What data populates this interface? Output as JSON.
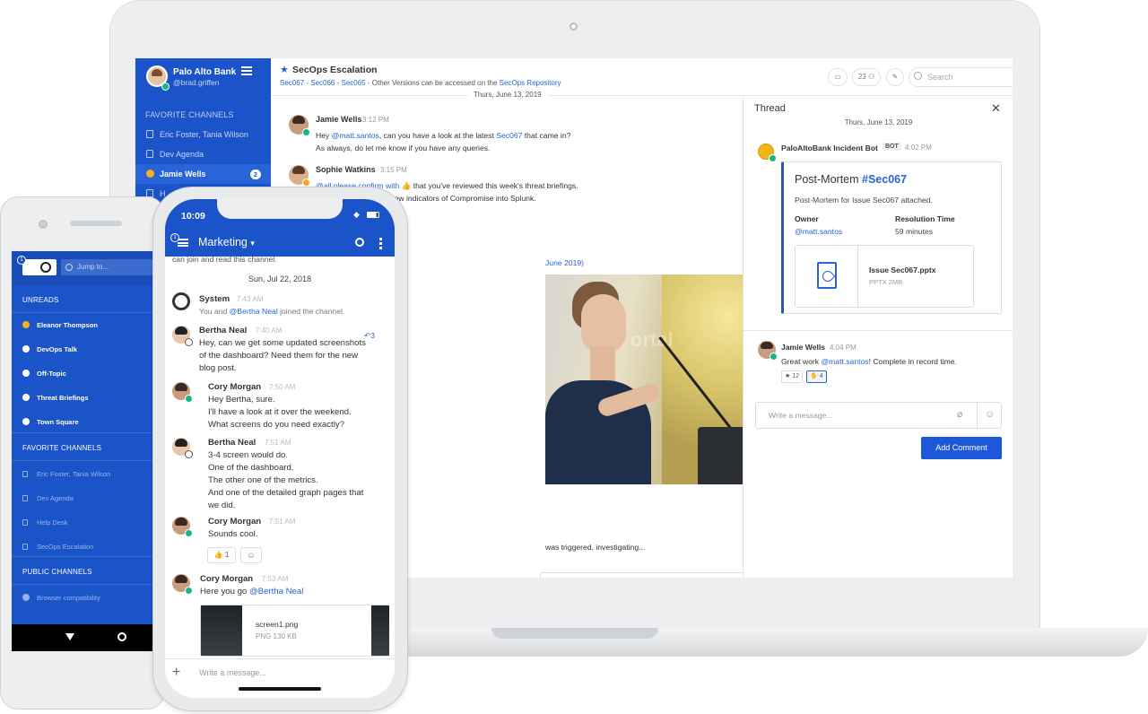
{
  "desktop": {
    "team": {
      "name": "Palo Alto Bank",
      "user": "@brad.griffen"
    },
    "sidebar": {
      "section_favorites": "FAVORITE CHANNELS",
      "items": [
        {
          "label": "Eric Foster, Tania Wilson"
        },
        {
          "label": "Dev Agenda"
        },
        {
          "label": "Jamie Wells",
          "badge": "2"
        },
        {
          "label": "H"
        }
      ]
    },
    "header": {
      "channel": "SecOps Escalation",
      "purpose_links": [
        "Sec067",
        "Sec066",
        "Sec065"
      ],
      "purpose_text": " - Other Versions can be accessed on the ",
      "purpose_repo": "SecOps Repository",
      "member_count": "23",
      "search_placeholder": "Search"
    },
    "center": {
      "date": "Thurs, June 13, 2019",
      "posts": [
        {
          "name": "Jamie Wells",
          "time": "3:12 PM",
          "line1_pre": "Hey ",
          "line1_mention": "@matt.santos",
          "line1_mid": ", can you have a look at the latest ",
          "line1_link": "Sec067",
          "line1_post": " that came in?",
          "line2": "As always, do let me know if you have any queries."
        },
        {
          "name": "Sophie Watkins",
          "time": "3:15 PM",
          "line1_a": "@all please confirm with ",
          "line1_b": " that you've reviewed this week's threat briefings.",
          "line2": "confirm we've loaded new indicators of Compromise into Splunk."
        }
      ],
      "link_text": "June 2019)",
      "tail_text": "was triggered, investigating..."
    },
    "thread": {
      "title": "Thread",
      "date": "Thurs, June 13, 2019",
      "bot_name": "PaloAltoBank Incident Bot",
      "bot_badge": "BOT",
      "bot_time": "4:02 PM",
      "card_title_pre": "Post-Mortem ",
      "card_title_tag": "#Sec067",
      "card_text": "Post-Mortem for Issue Sec067 attached.",
      "owner_label": "Owner",
      "owner_value": "@matt.santos",
      "resolution_label": "Resolution Time",
      "resolution_value": "59 minutes",
      "file_name": "Issue Sec067.pptx",
      "file_size": "PPTX 2MB",
      "reply_name": "Jamie Wells",
      "reply_time": "4:04 PM",
      "reply_pre": "Great work ",
      "reply_mention": "@matt.santos",
      "reply_post": "! Complete in record time.",
      "reaction1_count": "12",
      "reaction2_count": "4",
      "input_placeholder": "Write a message...",
      "add_button": "Add Comment"
    }
  },
  "android": {
    "badge": "1",
    "jump_placeholder": "Jump to...",
    "sections": {
      "unreads": "UNREADS",
      "favorites": "FAVORITE CHANNELS",
      "public": "PUBLIC CHANNELS"
    },
    "unreads": [
      "Eleanor Thompson",
      "DevOps Talk",
      "Off-Topic",
      "Threat Briefings",
      "Town Square"
    ],
    "favorites": [
      "Eric Foster, Tania Wilson",
      "Dev Agenda",
      "Help Desk",
      "SecOps Escalation"
    ],
    "public": [
      "Browser compatibility"
    ]
  },
  "iphone": {
    "time": "10:09",
    "badge": "1",
    "channel": "Marketing",
    "cut_text": "can join and read this channel.",
    "date": "Sun, Jul 22, 2018",
    "system": {
      "name": "System",
      "time": "7:43 AM",
      "pre": "You and ",
      "mention": "@Bertha Neal",
      "post": " joined the channel."
    },
    "bertha1": {
      "name": "Bertha Neal",
      "time": "7:40 AM",
      "reply_count": "3",
      "lines": [
        "Hey, can we get some updated screenshots",
        "of the dashboard? Need them for the new",
        "blog post."
      ]
    },
    "cory1": {
      "name": "Cory Morgan",
      "time": "7:50 AM",
      "lines": [
        "Hey Bertha, sure.",
        "I'll have a look at it over the weekend.",
        "What screens do you need exactly?"
      ]
    },
    "bertha2": {
      "name": "Bertha Neal",
      "time": "7:51 AM",
      "lines": [
        "3-4 screen would do.",
        "One of the dashboard.",
        "The other one of the metrics.",
        "And one of the detailed graph pages that",
        "we did."
      ]
    },
    "cory2": {
      "name": "Cory Morgan",
      "time": "7:51 AM",
      "line": "Sounds cool.",
      "reaction_count": "1"
    },
    "cory3": {
      "name": "Cory Morgan",
      "time": "7:53 AM",
      "pre": "Here you go ",
      "mention": "@Bertha Neal"
    },
    "file_name": "screen1.png",
    "file_size": "PNG 130 KB",
    "compose_placeholder": "Write a message..."
  },
  "colors": {
    "brand": "#1b54c9",
    "online": "#19b38b",
    "link": "#2863d6",
    "button": "#1c58d9"
  }
}
